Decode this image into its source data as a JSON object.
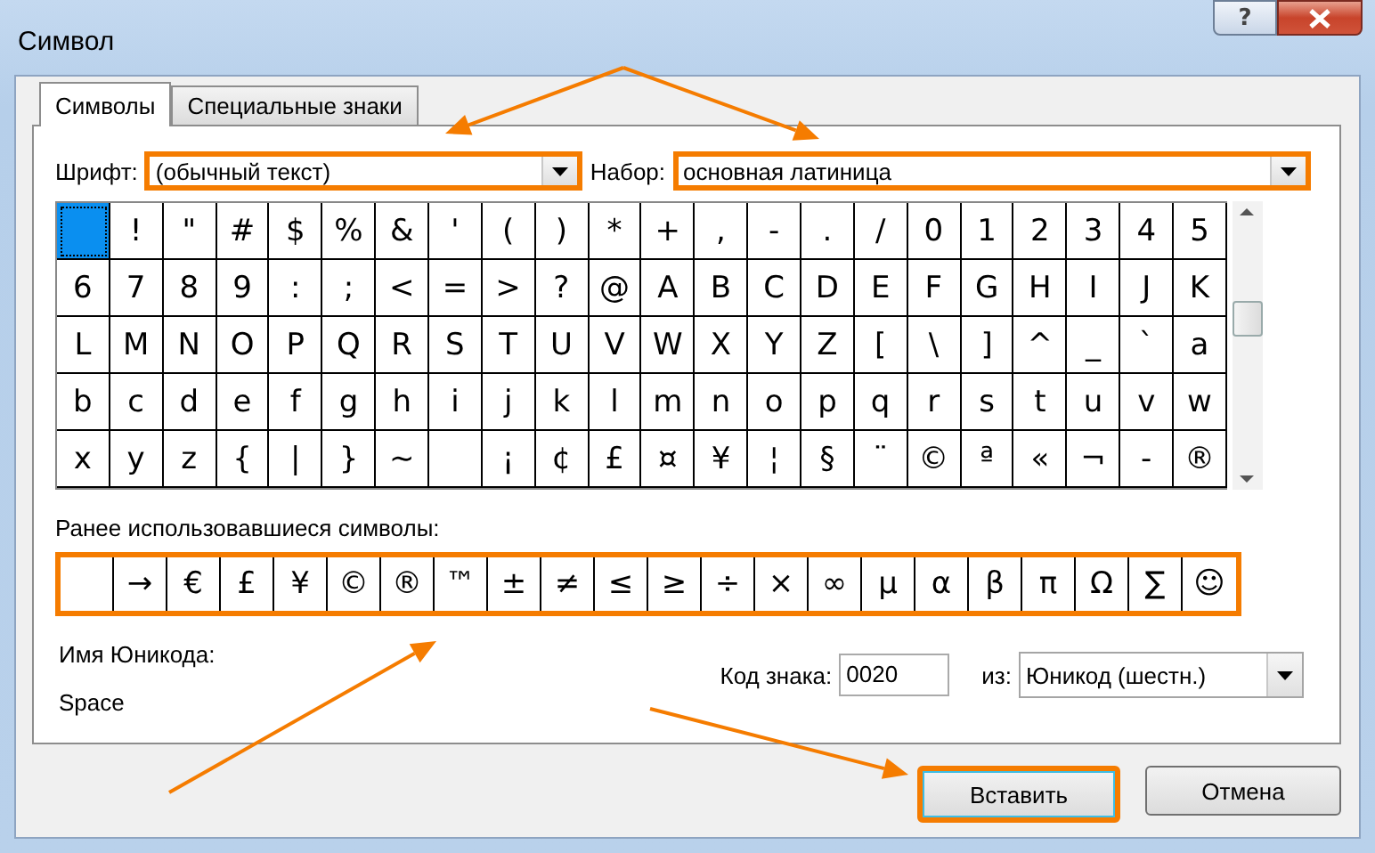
{
  "window": {
    "title": "Символ",
    "controls": [
      {
        "kind": "help",
        "label": "?"
      },
      {
        "kind": "close"
      }
    ]
  },
  "tabs": [
    {
      "label": "Символы",
      "selected": true
    },
    {
      "label": "Специальные знаки",
      "selected": false
    }
  ],
  "font": {
    "label": "Шрифт:",
    "value": "(обычный текст)",
    "highlighted": true
  },
  "subset": {
    "label": "Набор:",
    "value": "основная латиница",
    "highlighted": true
  },
  "grid": {
    "rows": [
      [
        {
          "selected": true
        },
        {
          "char": "!",
          "selected": false
        },
        {
          "char": "\"",
          "selected": false
        },
        {
          "char": "#",
          "selected": false
        },
        {
          "char": "$",
          "selected": false
        },
        {
          "char": "%",
          "selected": false
        },
        {
          "char": "&",
          "selected": false
        },
        {
          "char": "'",
          "selected": false
        },
        {
          "char": "(",
          "selected": false
        },
        {
          "char": ")",
          "selected": false
        },
        {
          "char": "*",
          "selected": false
        },
        {
          "char": "+",
          "selected": false
        },
        {
          "char": ",",
          "selected": false
        },
        {
          "char": "-",
          "selected": false
        },
        {
          "char": ".",
          "selected": false
        },
        {
          "char": "/",
          "selected": false
        },
        {
          "char": "0",
          "selected": false
        },
        {
          "char": "1",
          "selected": false
        },
        {
          "char": "2",
          "selected": false
        },
        {
          "char": "3",
          "selected": false
        },
        {
          "char": "4",
          "selected": false
        },
        {
          "char": "5",
          "selected": false
        }
      ],
      [
        {
          "char": "6",
          "selected": false
        },
        {
          "char": "7",
          "selected": false
        },
        {
          "char": "8",
          "selected": false
        },
        {
          "char": "9",
          "selected": false
        },
        {
          "char": ":",
          "selected": false
        },
        {
          "char": ";",
          "selected": false
        },
        {
          "char": "<",
          "selected": false
        },
        {
          "char": "=",
          "selected": false
        },
        {
          "char": ">",
          "selected": false
        },
        {
          "char": "?",
          "selected": false
        },
        {
          "char": "@",
          "selected": false
        },
        {
          "char": "A",
          "selected": false
        },
        {
          "char": "B",
          "selected": false
        },
        {
          "char": "C",
          "selected": false
        },
        {
          "char": "D",
          "selected": false
        },
        {
          "char": "E",
          "selected": false
        },
        {
          "char": "F",
          "selected": false
        },
        {
          "char": "G",
          "selected": false
        },
        {
          "char": "H",
          "selected": false
        },
        {
          "char": "I",
          "selected": false
        },
        {
          "char": "J",
          "selected": false
        },
        {
          "char": "K",
          "selected": false
        }
      ],
      [
        {
          "char": "L",
          "selected": false
        },
        {
          "char": "M",
          "selected": false
        },
        {
          "char": "N",
          "selected": false
        },
        {
          "char": "O",
          "selected": false
        },
        {
          "char": "P",
          "selected": false
        },
        {
          "char": "Q",
          "selected": false
        },
        {
          "char": "R",
          "selected": false
        },
        {
          "char": "S",
          "selected": false
        },
        {
          "char": "T",
          "selected": false
        },
        {
          "char": "U",
          "selected": false
        },
        {
          "char": "V",
          "selected": false
        },
        {
          "char": "W",
          "selected": false
        },
        {
          "char": "X",
          "selected": false
        },
        {
          "char": "Y",
          "selected": false
        },
        {
          "char": "Z",
          "selected": false
        },
        {
          "char": "[",
          "selected": false
        },
        {
          "char": "\\",
          "selected": false
        },
        {
          "char": "]",
          "selected": false
        },
        {
          "char": "^",
          "selected": false
        },
        {
          "char": "_",
          "selected": false
        },
        {
          "char": "`",
          "selected": false
        },
        {
          "char": "a",
          "selected": false
        }
      ],
      [
        {
          "char": "b",
          "selected": false
        },
        {
          "char": "c",
          "selected": false
        },
        {
          "char": "d",
          "selected": false
        },
        {
          "char": "e",
          "selected": false
        },
        {
          "char": "f",
          "selected": false
        },
        {
          "char": "g",
          "selected": false
        },
        {
          "char": "h",
          "selected": false
        },
        {
          "char": "i",
          "selected": false
        },
        {
          "char": "j",
          "selected": false
        },
        {
          "char": "k",
          "selected": false
        },
        {
          "char": "l",
          "selected": false
        },
        {
          "char": "m",
          "selected": false
        },
        {
          "char": "n",
          "selected": false
        },
        {
          "char": "o",
          "selected": false
        },
        {
          "char": "p",
          "selected": false
        },
        {
          "char": "q",
          "selected": false
        },
        {
          "char": "r",
          "selected": false
        },
        {
          "char": "s",
          "selected": false
        },
        {
          "char": "t",
          "selected": false
        },
        {
          "char": "u",
          "selected": false
        },
        {
          "char": "v",
          "selected": false
        },
        {
          "char": "w",
          "selected": false
        }
      ],
      [
        {
          "char": "x",
          "selected": false
        },
        {
          "char": "y",
          "selected": false
        },
        {
          "char": "z",
          "selected": false
        },
        {
          "char": "{",
          "selected": false
        },
        {
          "char": "|",
          "selected": false
        },
        {
          "char": "}",
          "selected": false
        },
        {
          "char": "~",
          "selected": false
        },
        {
          "selected": false
        },
        {
          "char": "¡",
          "selected": false
        },
        {
          "char": "¢",
          "selected": false
        },
        {
          "char": "£",
          "selected": false
        },
        {
          "char": "¤",
          "selected": false
        },
        {
          "char": "¥",
          "selected": false
        },
        {
          "char": "¦",
          "selected": false
        },
        {
          "char": "§",
          "selected": false
        },
        {
          "char": "¨",
          "selected": false
        },
        {
          "char": "©",
          "selected": false
        },
        {
          "char": "ª",
          "selected": false
        },
        {
          "char": "«",
          "selected": false
        },
        {
          "char": "¬",
          "selected": false
        },
        {
          "char": "-",
          "selected": false
        },
        {
          "char": "®",
          "selected": false
        }
      ]
    ]
  },
  "recent": {
    "label": "Ранее использовавшиеся символы:",
    "highlighted": true,
    "symbols": [
      {
        "kind": "blank"
      },
      {
        "kind": "symbol",
        "char": "→"
      },
      {
        "kind": "symbol",
        "char": "€"
      },
      {
        "kind": "symbol",
        "char": "£"
      },
      {
        "kind": "symbol",
        "char": "¥"
      },
      {
        "kind": "symbol",
        "char": "©"
      },
      {
        "kind": "symbol",
        "char": "®"
      },
      {
        "kind": "symbol",
        "char": "™"
      },
      {
        "kind": "symbol",
        "char": "±"
      },
      {
        "kind": "symbol",
        "char": "≠"
      },
      {
        "kind": "symbol",
        "char": "≤"
      },
      {
        "kind": "symbol",
        "char": "≥"
      },
      {
        "kind": "symbol",
        "char": "÷"
      },
      {
        "kind": "symbol",
        "char": "×"
      },
      {
        "kind": "symbol",
        "char": "∞"
      },
      {
        "kind": "symbol",
        "char": "µ"
      },
      {
        "kind": "symbol",
        "char": "α"
      },
      {
        "kind": "symbol",
        "char": "β"
      },
      {
        "kind": "symbol",
        "char": "π"
      },
      {
        "kind": "symbol",
        "char": "Ω"
      },
      {
        "kind": "symbol",
        "char": "∑"
      },
      {
        "kind": "symbol",
        "char": "☺"
      }
    ]
  },
  "unicode_name": {
    "label": "Имя Юникода:",
    "value": "Space"
  },
  "char_code": {
    "label": "Код знака:",
    "value": "0020"
  },
  "from": {
    "label": "из:",
    "value": "Юникод (шестн.)"
  },
  "buttons": [
    {
      "label": "Вставить",
      "highlighted": true
    },
    {
      "label": "Отмена",
      "highlighted": false
    }
  ]
}
